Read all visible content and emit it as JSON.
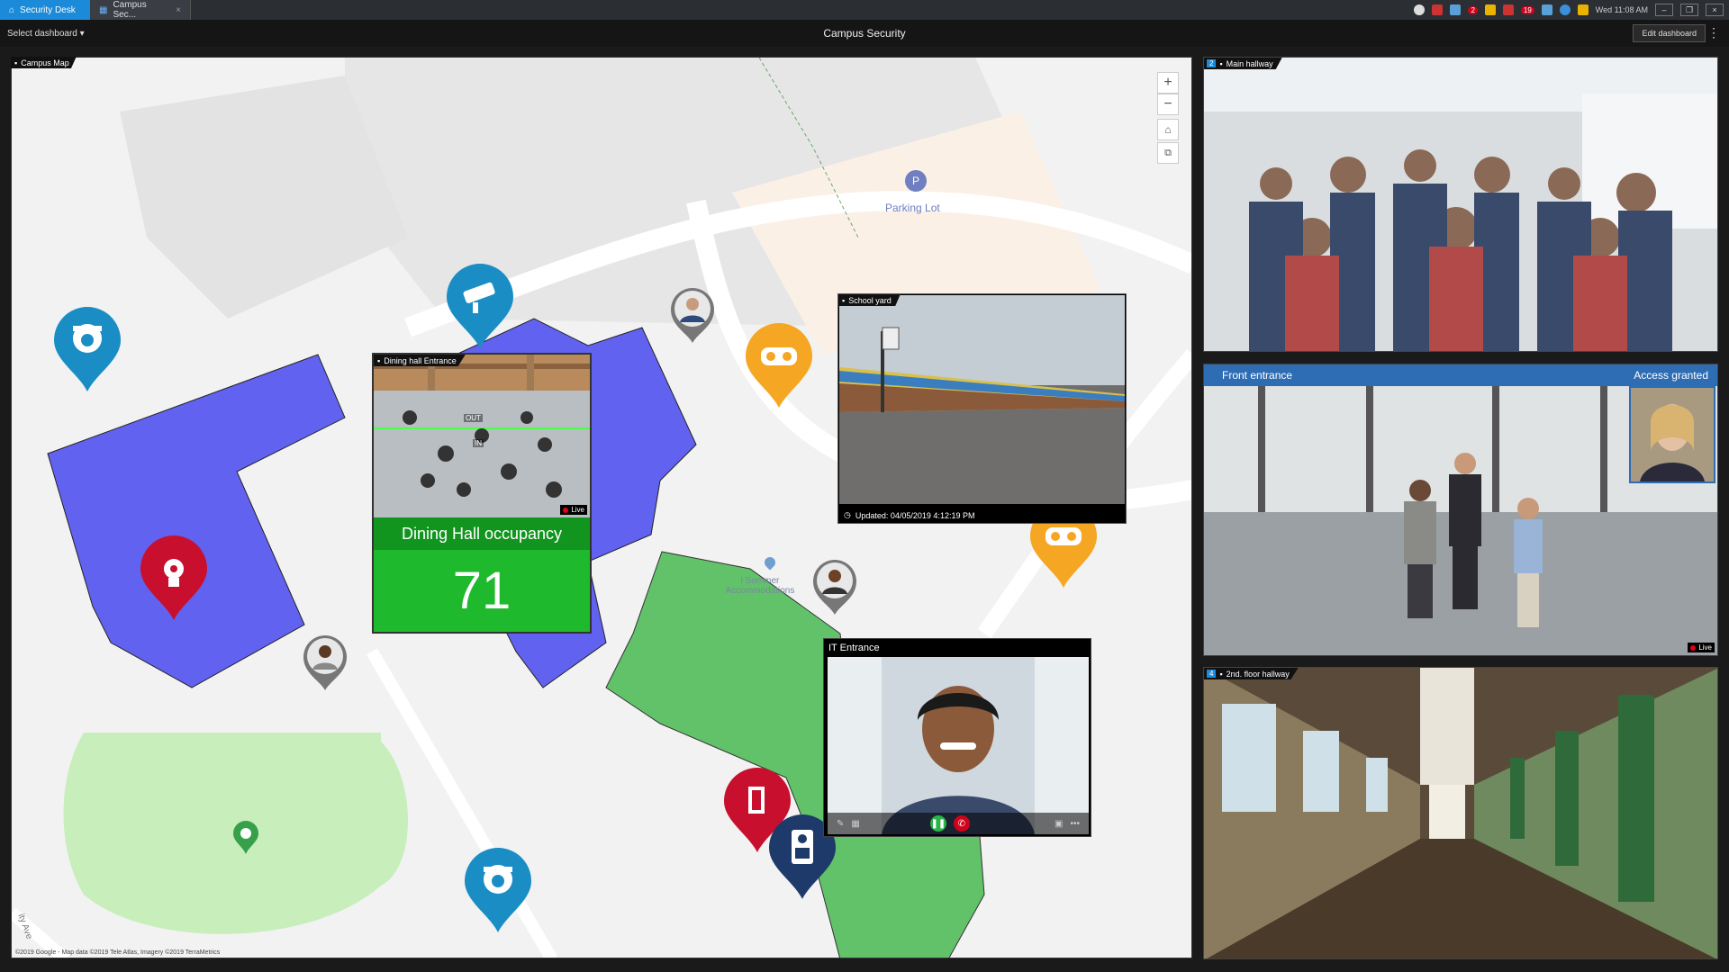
{
  "tabs": [
    {
      "label": "Security Desk",
      "icon": "home-icon"
    },
    {
      "label": "Campus Sec...",
      "icon": "grid-icon"
    }
  ],
  "tray": {
    "badge1": "2",
    "badge2": "19",
    "clock": "Wed 11:08 AM"
  },
  "header": {
    "select_dashboard": "Select dashboard",
    "title": "Campus Security",
    "edit_button": "Edit dashboard"
  },
  "map": {
    "label": "Campus Map",
    "parking_label": "Parking Lot",
    "accommodation_label": "l Sommer Accommodations",
    "street_label": "ity Ave",
    "attribution": "©2019 Google - Map data ©2019 Tele Atlas, Imagery ©2019 TerraMetrics"
  },
  "tiles": {
    "dining": {
      "camera": "Dining hall Entrance",
      "title": "Dining Hall occupancy",
      "count": "71",
      "live": "Live",
      "out_label": "OUT",
      "in_label": "IN"
    },
    "schoolyard": {
      "camera": "School yard",
      "updated": "Updated: 04/05/2019 4:12:19 PM"
    },
    "it_entrance": {
      "title": "IT Entrance"
    }
  },
  "cameras": {
    "main": {
      "num": "2",
      "label": "Main hallway"
    },
    "front": {
      "label": "Front entrance",
      "status": "Access granted",
      "live": "Live"
    },
    "floor2": {
      "num": "4",
      "label": "2nd. floor hallway"
    }
  },
  "colors": {
    "accent": "#1b8ad8",
    "building": "#6262f0",
    "green_area": "#62c26a",
    "light_green": "#c8eebc",
    "pin_blue": "#1a8ec4",
    "pin_red": "#c8102e",
    "pin_orange": "#f5a623",
    "pin_navy": "#1d3a6b",
    "occupancy_green": "#1fb92d"
  }
}
